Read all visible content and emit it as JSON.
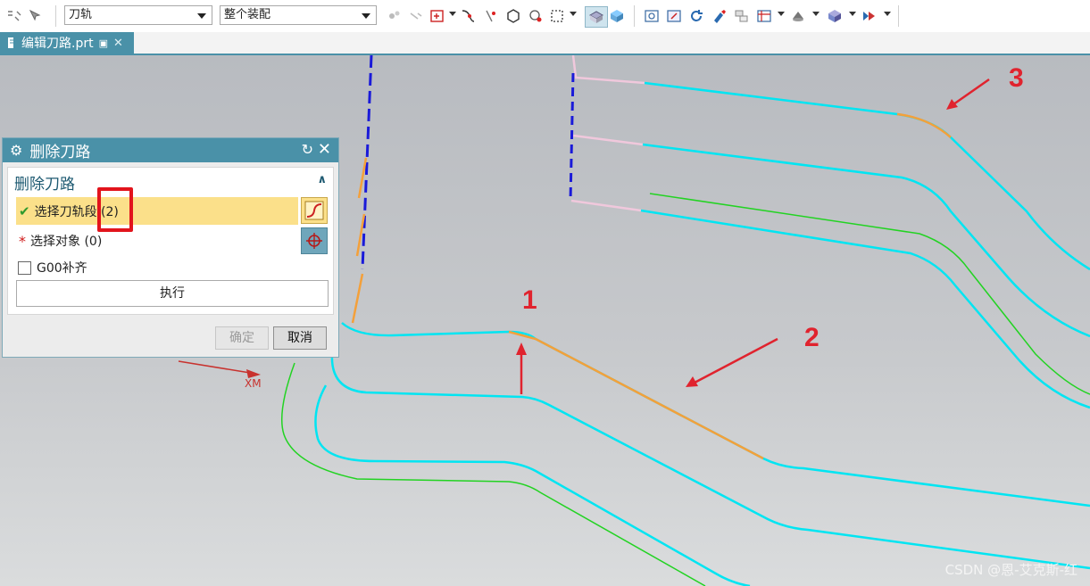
{
  "toolbar": {
    "combo_toolpath": "刀轨",
    "combo_assembly": "整个装配",
    "icons": [
      "filter-icon",
      "select-icon",
      "snap-point-icon",
      "curve-icon",
      "hexagon-icon",
      "region-select-icon",
      "shaded-view-icon",
      "solid-view-icon",
      "fit-view-icon",
      "zoom-icon",
      "rotate-icon",
      "pan-icon",
      "layer-icon",
      "grid-icon",
      "lighting-icon",
      "cube-icon",
      "render-icon"
    ]
  },
  "tabs": {
    "doc_tab_label": "编辑刀路.prt"
  },
  "dialog": {
    "title": "删除刀路",
    "group_title": "删除刀路",
    "select_toolpath_label": "选择刀轨段 (2)",
    "select_object_label": "选择对象 (0)",
    "g00_checkbox_label": "G00补齐",
    "g00_checked": false,
    "execute_label": "执行",
    "ok_label": "确定",
    "cancel_label": "取消",
    "ok_enabled": false
  },
  "annotations": {
    "label_1": "1",
    "label_2": "2",
    "label_3": "3",
    "axis_label": "XM",
    "accent_color": "#e0232e"
  },
  "colors": {
    "cyan_path": "#00e5f2",
    "orange_segment": "#f4a03a",
    "green_path": "#22d322",
    "blue_axis": "#1a1ad9",
    "pink_path": "#f0c8dc",
    "dialog_title_bg": "#4a91a8",
    "highlight_row": "#fbe08a"
  },
  "watermark": "CSDN @恩-艾克斯-红"
}
